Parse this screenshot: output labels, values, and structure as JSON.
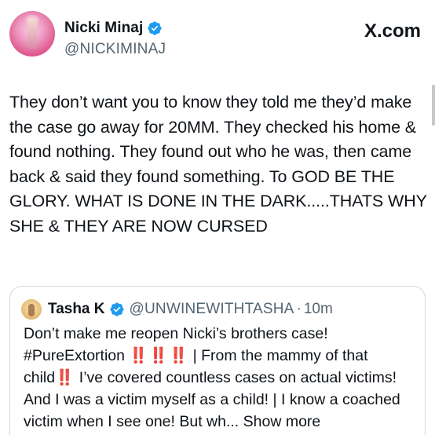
{
  "post": {
    "author": {
      "display_name": "Nicki Minaj",
      "handle": "@NICKIMINAJ",
      "verified": true,
      "verified_color": "#1d9bf0"
    },
    "platform_label": "X.com",
    "text": "They don’t want you to know they told me they’d make the case go away for 20MM. They checked his home & found nothing. They found out who he was, then came back & said they found something. To GOD BE THE GLORY. WHAT IS DONE IN THE DARK.....THATS WHY SHE & THEY ARE NOW CURSED"
  },
  "quoted_post": {
    "author": {
      "display_name": "Tasha K",
      "handle": "@UNWINEWITHTASHA",
      "verified": true,
      "verified_color": "#1d9bf0"
    },
    "separator": "·",
    "timestamp": "10m",
    "text_parts": {
      "part1": "Don’t make me reopen Nicki’s brothers case! #PureExtortion ",
      "bang1": "‼️",
      "bang2": "‼️",
      "bang3": "‼️",
      "part2": " | From the mammy of that child",
      "bang4": "‼️",
      "part3": " I’ve covered countless cases on actual victims! And I was a victim myself as a child! | I know a coached victim when I see one! But wh...",
      "show_more": " Show more"
    }
  },
  "colors": {
    "text": "#0f1419",
    "secondary": "#536471",
    "border": "#cfd9de",
    "emoji_red": "#e0245e"
  }
}
